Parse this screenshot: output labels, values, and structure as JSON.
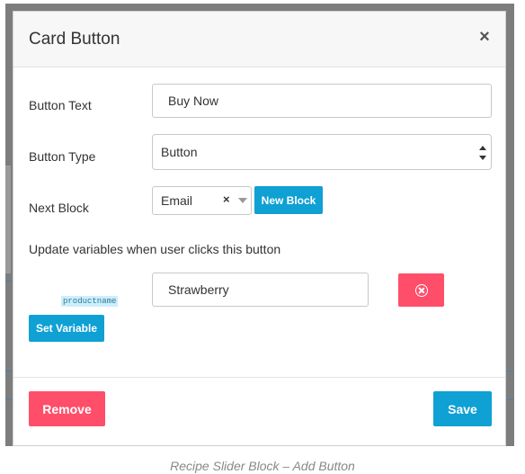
{
  "modal": {
    "title": "Card Button",
    "close_glyph": "×"
  },
  "form": {
    "button_text": {
      "label": "Button Text",
      "value": "Buy Now"
    },
    "button_type": {
      "label": "Button Type",
      "value": "Button"
    },
    "next_block": {
      "label": "Next Block",
      "value": "Email",
      "clear_glyph": "×",
      "new_block_label": "New Block"
    },
    "variables": {
      "heading": "Update variables when user clicks this button",
      "tag": "productname",
      "value": "Strawberry",
      "set_variable_label": "Set Variable"
    }
  },
  "footer": {
    "remove_label": "Remove",
    "save_label": "Save"
  },
  "caption": "Recipe Slider Block – Add Button",
  "colors": {
    "primary": "#0fa0d4",
    "danger": "#ff4e6a"
  }
}
